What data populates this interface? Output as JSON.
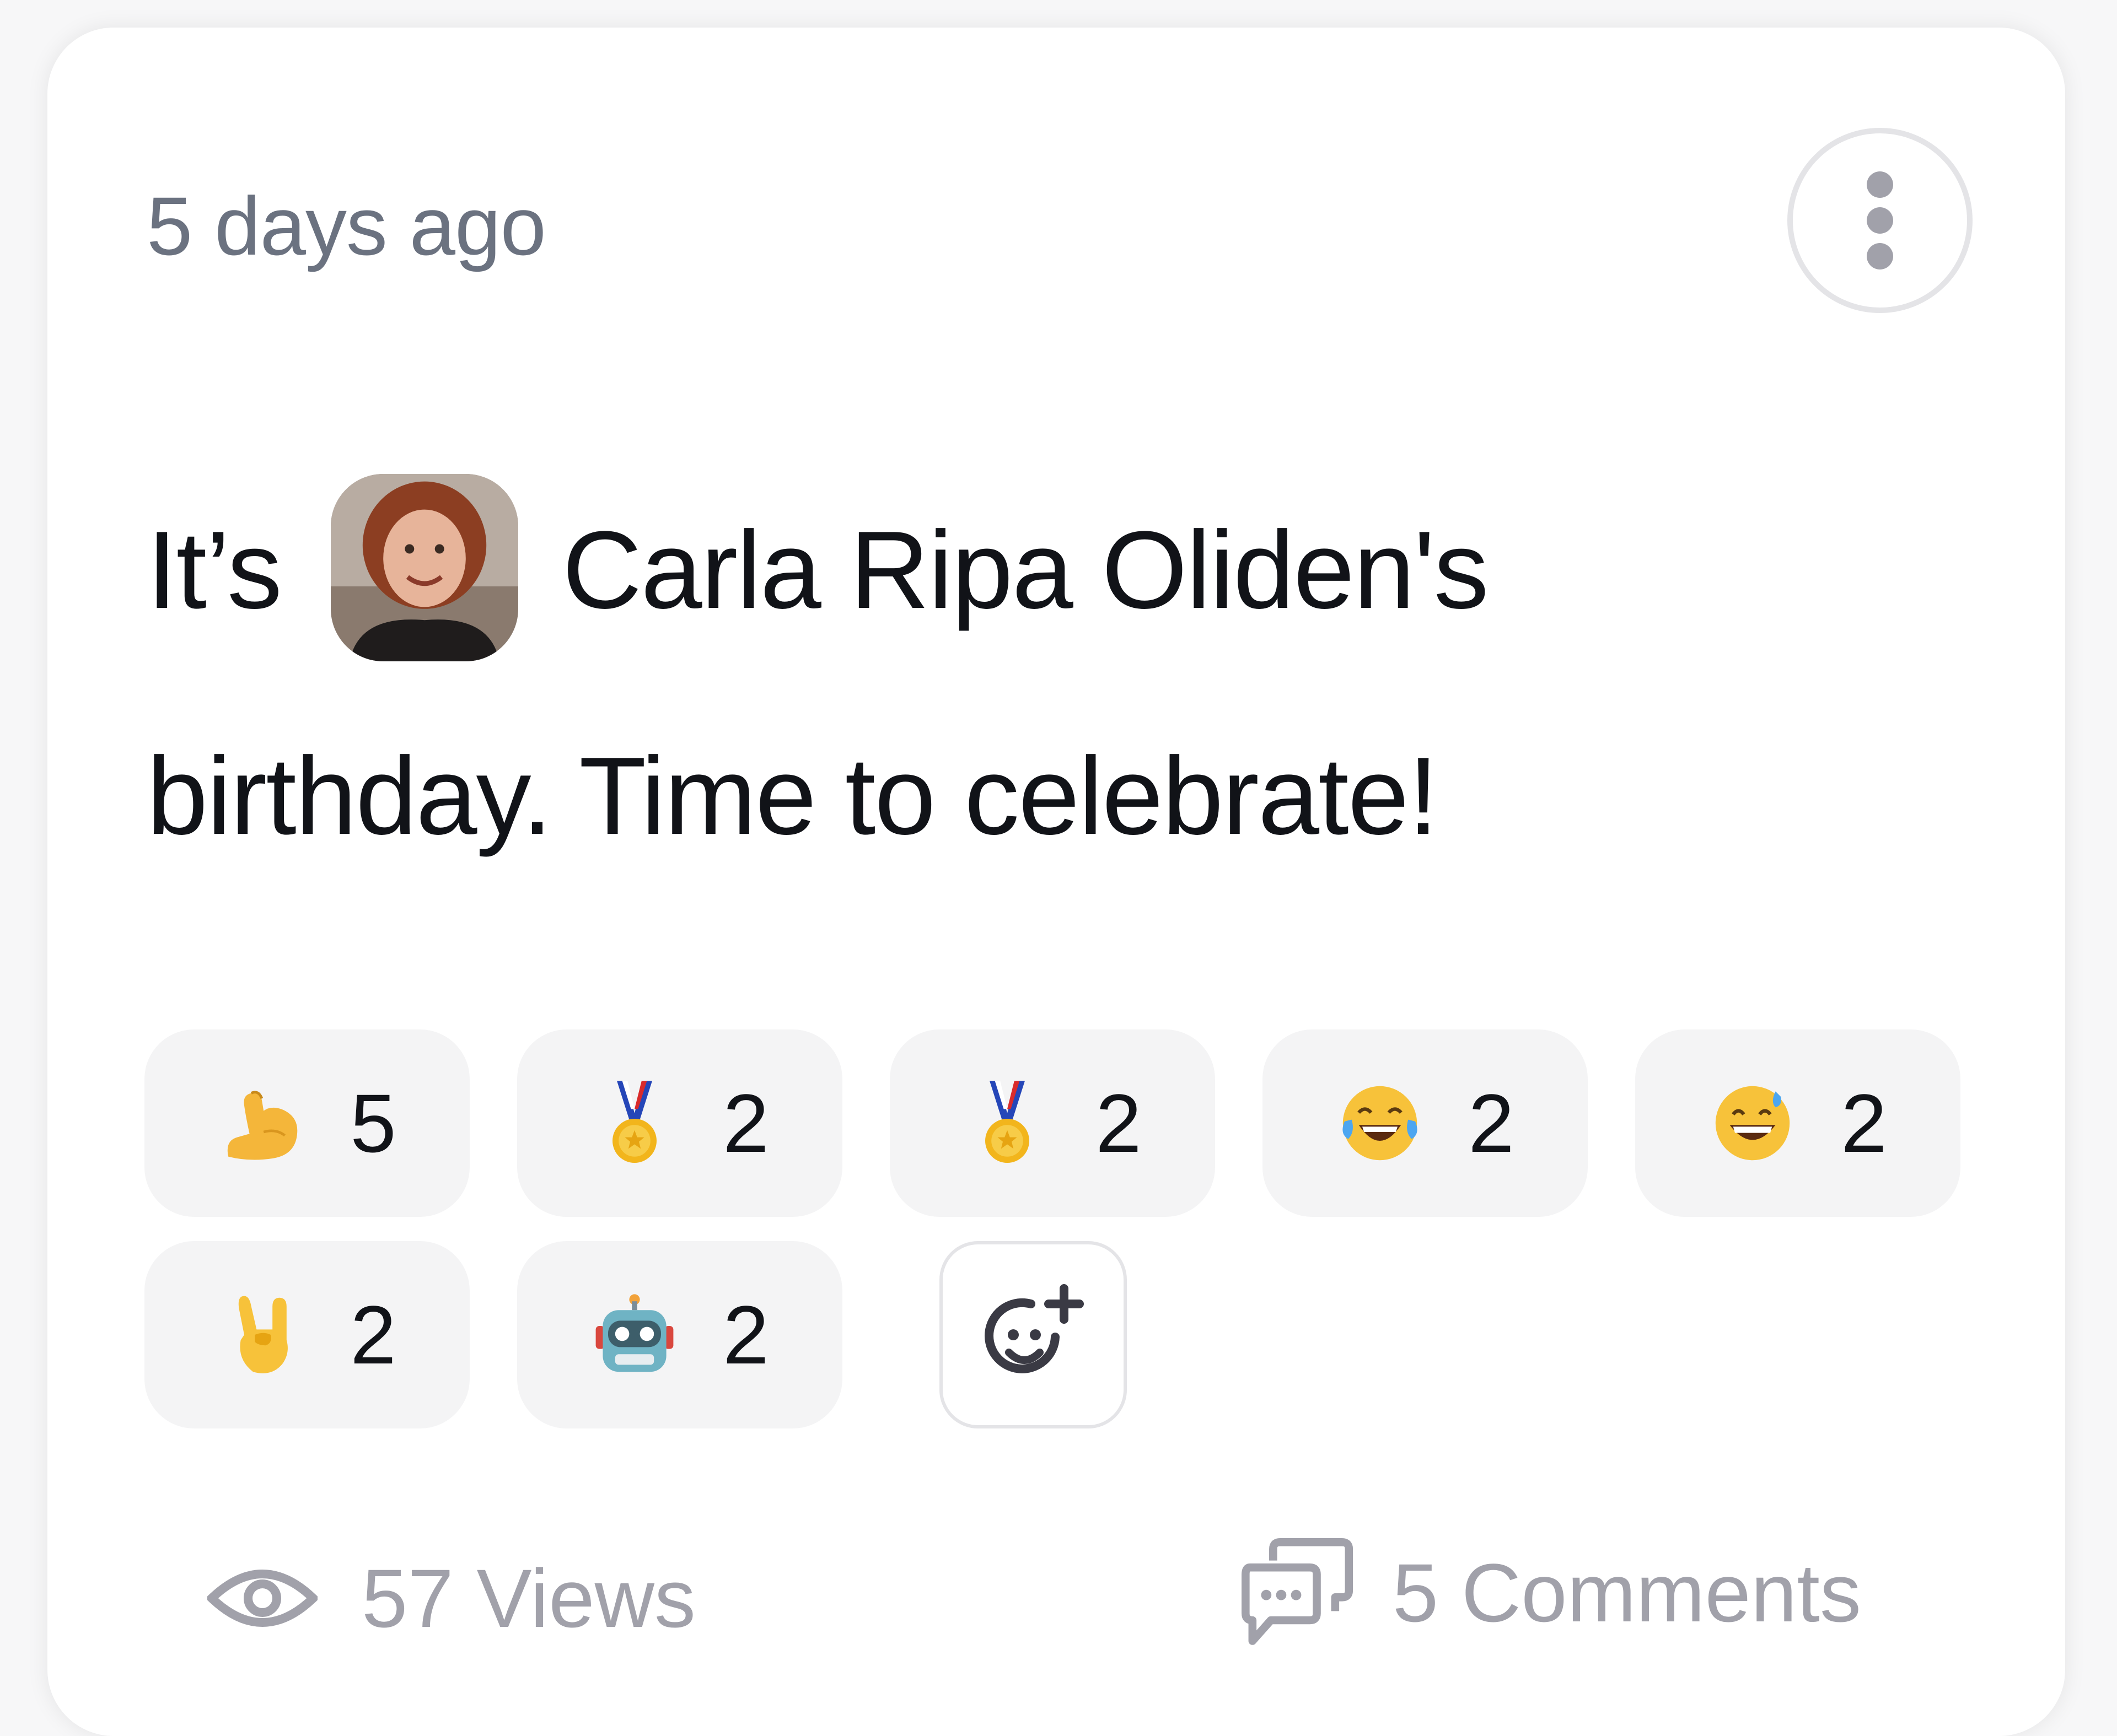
{
  "post": {
    "timestamp": "5 days ago",
    "message_prefix": "It’s",
    "person_name": "Carla Ripa Oliden's",
    "message_suffix": "birthday. Time to celebrate!"
  },
  "reactions": [
    {
      "emoji": "flexed-biceps",
      "count": "5"
    },
    {
      "emoji": "medal",
      "count": "2"
    },
    {
      "emoji": "medal",
      "count": "2"
    },
    {
      "emoji": "face-with-tears-of-joy",
      "count": "2"
    },
    {
      "emoji": "grinning-face-with-sweat",
      "count": "2"
    },
    {
      "emoji": "sign-of-the-horns",
      "count": "2"
    },
    {
      "emoji": "robot",
      "count": "2"
    }
  ],
  "footer": {
    "views": "57 Views",
    "comments": "5 Comments"
  },
  "colors": {
    "card_bg": "#ffffff",
    "pill_bg": "#f4f4f5",
    "muted_text": "#a1a1aa",
    "timestamp_text": "#6b7280",
    "body_text": "#111318"
  },
  "icons": {
    "more": "vertical-ellipsis-icon",
    "add_reaction": "add-emoji-icon",
    "views": "eye-icon",
    "comments": "chat-bubbles-icon"
  }
}
